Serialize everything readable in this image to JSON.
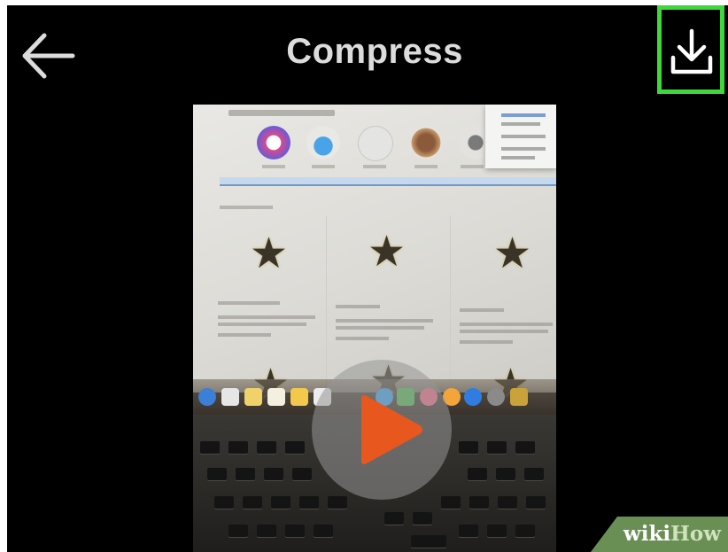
{
  "header": {
    "title": "Compress",
    "back_icon": "arrow-left-icon",
    "download_icon": "download-icon",
    "highlight_color": "#3fd83a"
  },
  "video": {
    "play_icon": "play-icon",
    "play_color": "#e8571d"
  },
  "watermark": {
    "part1": "wiki",
    "part2": "How",
    "color": "#6a8f55"
  }
}
